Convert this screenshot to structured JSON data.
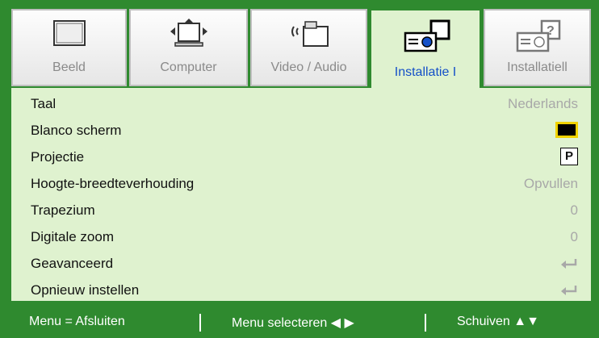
{
  "tabs": [
    {
      "label": "Beeld",
      "icon": "monitor-icon",
      "active": false
    },
    {
      "label": "Computer",
      "icon": "computer-icon",
      "active": false
    },
    {
      "label": "Video / Audio",
      "icon": "video-audio-icon",
      "active": false
    },
    {
      "label": "Installatie I",
      "icon": "projector-icon",
      "active": true
    },
    {
      "label": "Installatiell",
      "icon": "projector-settings-icon",
      "active": false
    }
  ],
  "settings": {
    "language": {
      "label": "Taal",
      "value": "Nederlands"
    },
    "blank_screen": {
      "label": "Blanco scherm",
      "value_icon": "black-swatch-icon",
      "value_color": "#000000"
    },
    "projection": {
      "label": "Projectie",
      "value": "P"
    },
    "aspect_ratio": {
      "label": "Hoogte-breedteverhouding",
      "value": "Opvullen"
    },
    "keystone": {
      "label": "Trapezium",
      "value": "0"
    },
    "digital_zoom": {
      "label": "Digitale zoom",
      "value": "0"
    },
    "advanced": {
      "label": "Geavanceerd",
      "value_icon": "enter-icon"
    },
    "reset": {
      "label": "Opnieuw instellen",
      "value_icon": "enter-icon"
    }
  },
  "footer": {
    "menu_exit": "Menu = Afsluiten",
    "menu_select": "Menu selecteren ◀ ▶",
    "scroll": "Schuiven ▲▼"
  },
  "colors": {
    "accent_green": "#2f8a2f",
    "panel_bg": "#dff2cf",
    "active_tab_text": "#1450c8",
    "value_gray": "#a8a8a8",
    "highlight_yellow": "#f0d200"
  }
}
